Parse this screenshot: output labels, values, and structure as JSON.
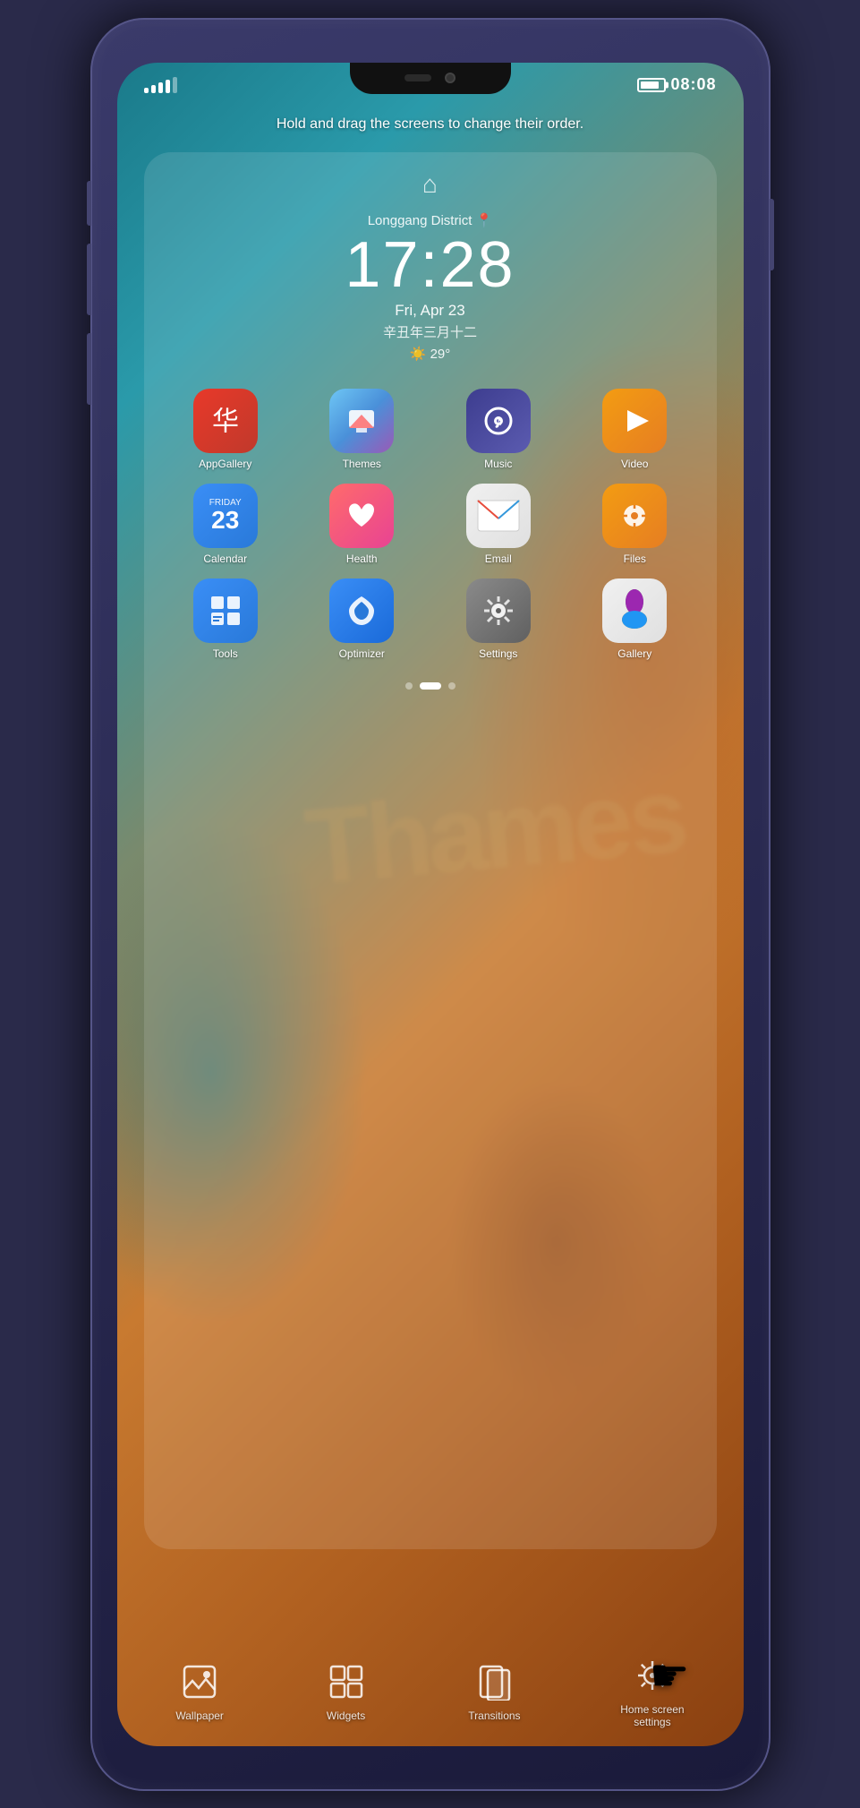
{
  "phone": {
    "status_bar": {
      "time": "08:08",
      "battery_level": 80
    },
    "hint_text": "Hold and drag the screens to change their order.",
    "home_icon": "🏠",
    "clock": {
      "location": "Longgang District 📍",
      "time": "17:28",
      "date": "Fri, Apr 23",
      "lunar": "辛丑年三月十二",
      "weather": "☀️ 29°"
    },
    "apps": [
      {
        "id": "appgallery",
        "label": "AppGallery",
        "icon_type": "huawei"
      },
      {
        "id": "themes",
        "label": "Themes",
        "icon_type": "themes"
      },
      {
        "id": "music",
        "label": "Music",
        "icon_type": "music"
      },
      {
        "id": "video",
        "label": "Video",
        "icon_type": "video"
      },
      {
        "id": "calendar",
        "label": "Calendar",
        "icon_type": "calendar",
        "day": "23",
        "day_label": "Friday"
      },
      {
        "id": "health",
        "label": "Health",
        "icon_type": "health"
      },
      {
        "id": "email",
        "label": "Email",
        "icon_type": "email"
      },
      {
        "id": "files",
        "label": "Files",
        "icon_type": "files"
      },
      {
        "id": "tools",
        "label": "Tools",
        "icon_type": "tools"
      },
      {
        "id": "optimizer",
        "label": "Optimizer",
        "icon_type": "optimizer"
      },
      {
        "id": "settings",
        "label": "Settings",
        "icon_type": "settings"
      },
      {
        "id": "gallery",
        "label": "Gallery",
        "icon_type": "gallery"
      }
    ],
    "page_indicators": [
      {
        "active": false
      },
      {
        "active": true
      },
      {
        "active": false
      }
    ],
    "dock": [
      {
        "id": "wallpaper",
        "label": "Wallpaper",
        "icon": "🖼"
      },
      {
        "id": "widgets",
        "label": "Widgets",
        "icon": "▦"
      },
      {
        "id": "transitions",
        "label": "Transitions",
        "icon": "❐"
      },
      {
        "id": "homescreen-settings",
        "label": "Home screen\nsettings",
        "icon": "⚙"
      }
    ],
    "background_text": "Thames"
  }
}
